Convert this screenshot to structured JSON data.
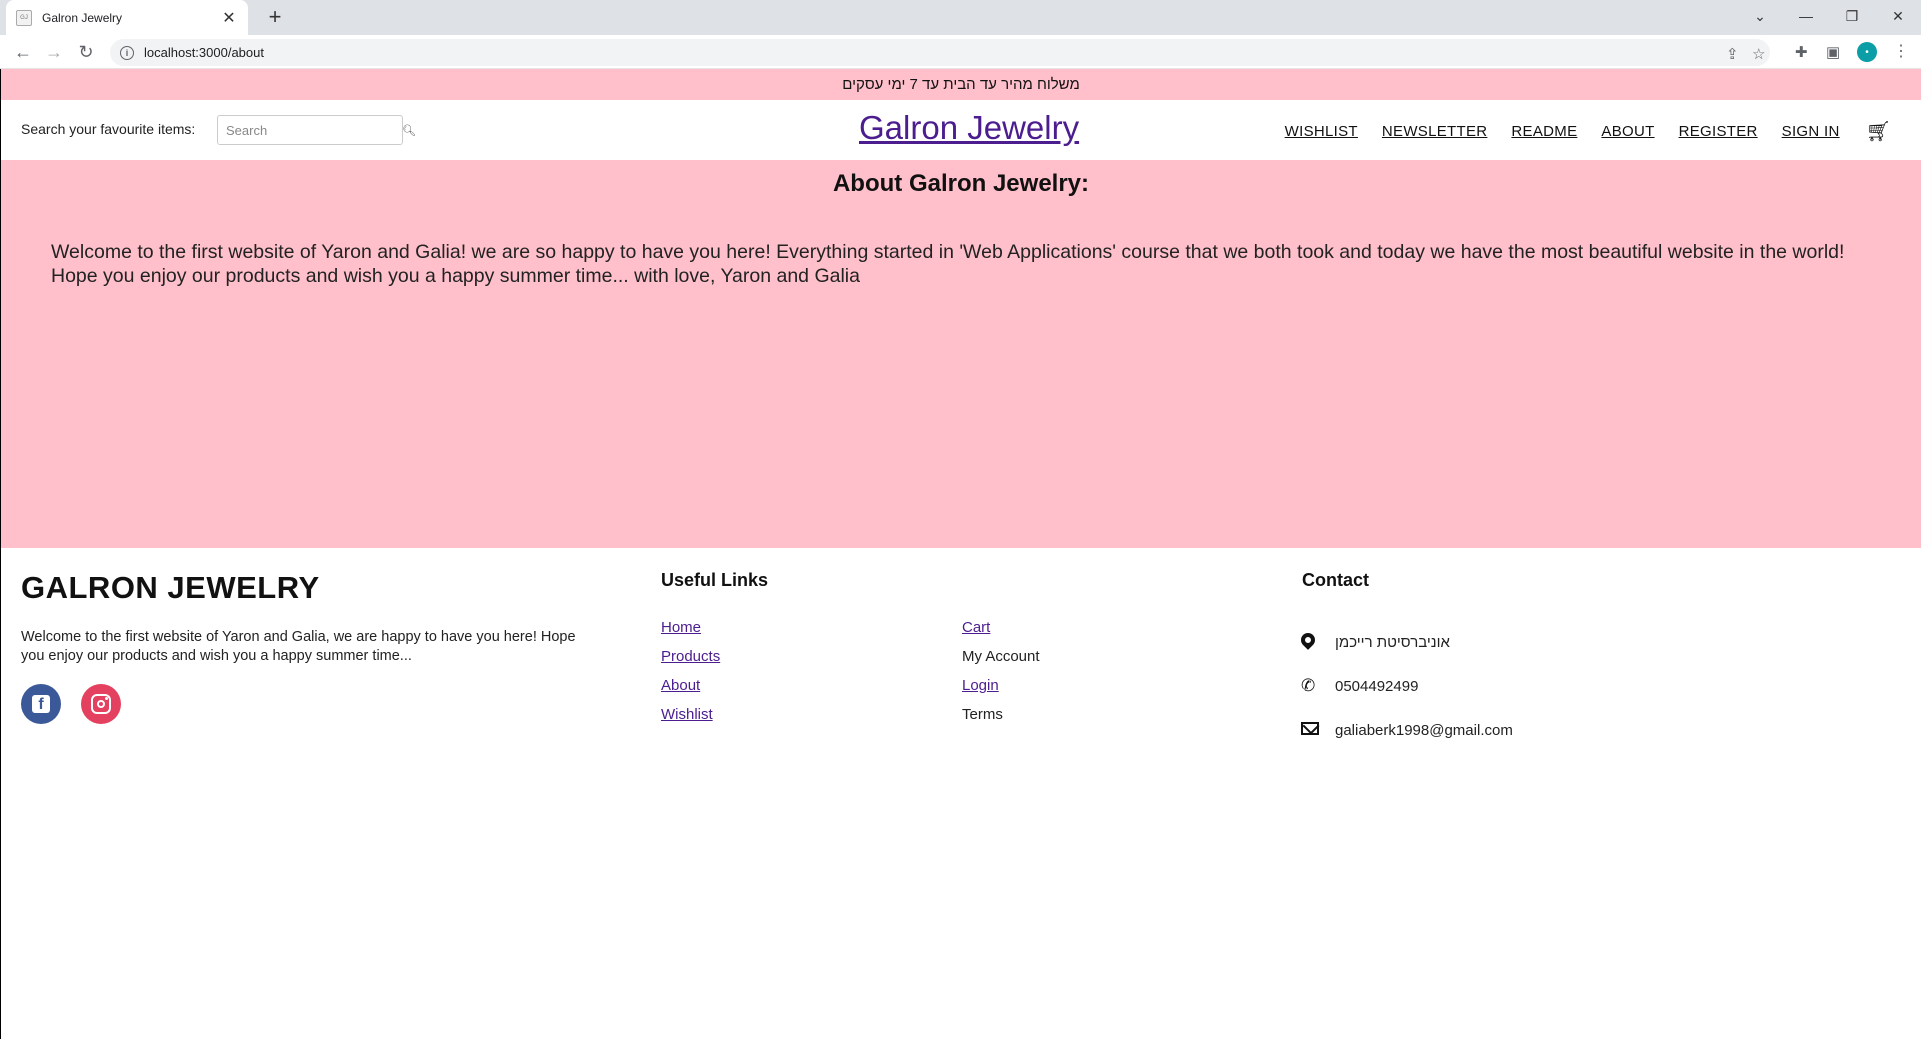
{
  "browser": {
    "tab_title": "Galron Jewelry",
    "url": "localhost:3000/about",
    "profile_initial": "•"
  },
  "promo": {
    "text": "משלוח מהיר עד הבית עד 7 ימי עסקים"
  },
  "header": {
    "search_label": "Search your favourite items:",
    "search_placeholder": "Search",
    "brand": "Galron Jewelry",
    "nav": [
      "WISHLIST",
      "NEWSLETTER",
      "README",
      "ABOUT",
      "REGISTER",
      "SIGN IN"
    ]
  },
  "about": {
    "title": "About Galron Jewelry:",
    "body": "Welcome to the first website of Yaron and Galia! we are so happy to have you here! Everything started in 'Web Applications' course that we both took and today we have the most beautiful website in the world! Hope you enjoy our products and wish you a happy summer time... with love, Yaron and Galia"
  },
  "footer": {
    "brand": "GALRON JEWELRY",
    "description": "Welcome to the first website of Yaron and Galia, we are happy to have you here! Hope you enjoy our products and wish you a happy summer time...",
    "useful_links_title": "Useful Links",
    "links_col1": [
      "Home",
      "Products",
      "About",
      "Wishlist"
    ],
    "links_col2": [
      "Cart",
      "My Account",
      "Login",
      "Terms"
    ],
    "contact_title": "Contact",
    "address": "אוניברסיטת רייכמן",
    "phone": "0504492499",
    "email": "galiaberk1998@gmail.com"
  },
  "colors": {
    "pink": "#ffc0cb",
    "brand_purple": "#4b1d8f",
    "facebook": "#3b5999",
    "instagram": "#e4405f"
  }
}
